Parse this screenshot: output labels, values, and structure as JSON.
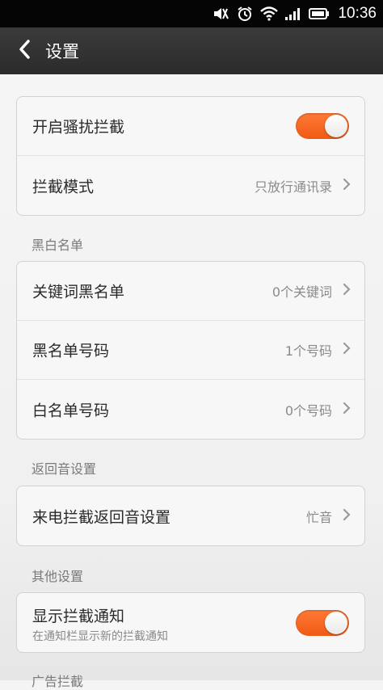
{
  "status_bar": {
    "time": "10:36",
    "icons": [
      "mute-icon",
      "alarm-icon",
      "wifi-icon",
      "signal-icon",
      "battery-icon"
    ]
  },
  "header": {
    "title": "设置",
    "back_icon": "chevron-left-icon"
  },
  "colors": {
    "toggle_on": "#f5651f",
    "header_bg": "#2e2e2e",
    "status_bar_bg": "#050505"
  },
  "sections": [
    {
      "header": "",
      "items": [
        {
          "label": "开启骚扰拦截",
          "type": "toggle",
          "on": true
        },
        {
          "label": "拦截模式",
          "value": "只放行通讯录",
          "type": "link"
        }
      ]
    },
    {
      "header": "黑白名单",
      "items": [
        {
          "label": "关键词黑名单",
          "value": "0个关键词",
          "type": "link"
        },
        {
          "label": "黑名单号码",
          "value": "1个号码",
          "type": "link"
        },
        {
          "label": "白名单号码",
          "value": "0个号码",
          "type": "link"
        }
      ]
    },
    {
      "header": "返回音设置",
      "items": [
        {
          "label": "来电拦截返回音设置",
          "value": "忙音",
          "type": "link"
        }
      ]
    },
    {
      "header": "其他设置",
      "items": [
        {
          "label": "显示拦截通知",
          "subtitle": "在通知栏显示新的拦截通知",
          "type": "toggle",
          "on": true
        }
      ]
    },
    {
      "header": "广告拦截",
      "items": []
    }
  ]
}
